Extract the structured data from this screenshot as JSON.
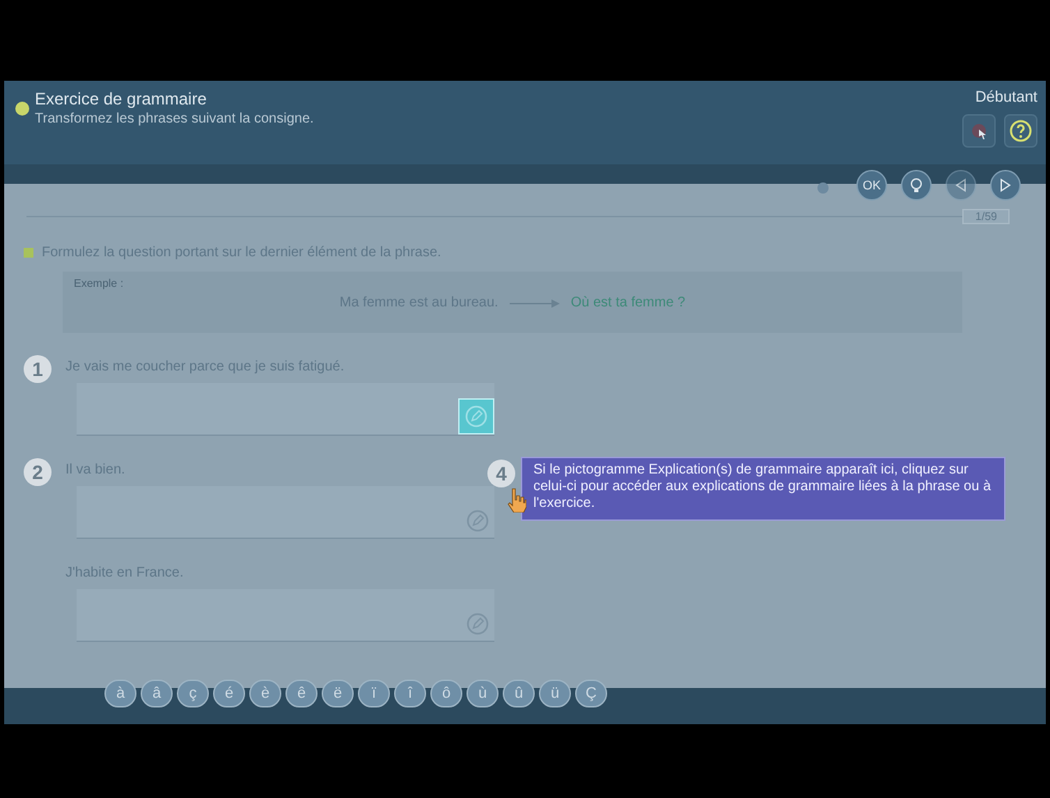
{
  "header": {
    "title": "Exercice de grammaire",
    "subtitle": "Transformez les phrases suivant la consigne.",
    "level": "Débutant"
  },
  "toolbar": {
    "ok": "OK",
    "progress": "1/59"
  },
  "instruction": "Formulez la question portant sur le dernier élément de la phrase.",
  "example": {
    "label": "Exemple :",
    "sentence": "Ma femme est au bureau.",
    "answer": "Où est ta femme ?"
  },
  "items": [
    {
      "number": "1",
      "sentence": "Je vais me coucher parce que je suis fatigué.",
      "highlighted": true
    },
    {
      "number": "2",
      "sentence": "Il va bien.",
      "highlighted": false
    },
    {
      "sentence": "J'habite en France.",
      "highlighted": false
    }
  ],
  "tooltip": {
    "number": "4",
    "text": "Si le pictogramme Explication(s) de grammaire apparaît ici, cliquez sur celui-ci pour accéder aux explications de grammaire liées à la phrase ou à l'exercice."
  },
  "accent_keys": [
    "à",
    "â",
    "ç",
    "é",
    "è",
    "ê",
    "ë",
    "ï",
    "î",
    "ô",
    "ù",
    "û",
    "ü",
    "Ç"
  ]
}
